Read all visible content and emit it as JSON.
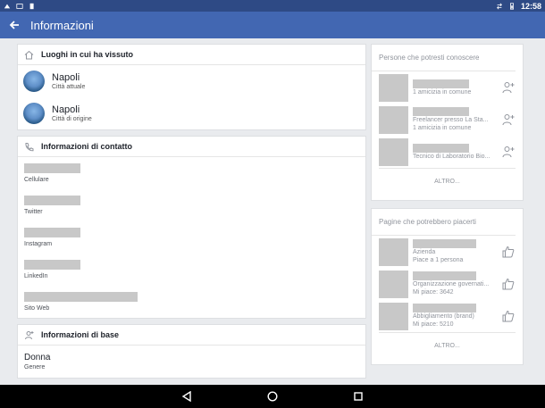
{
  "status_bar": {
    "time": "12:58"
  },
  "app_bar": {
    "title": "Informazioni"
  },
  "places": {
    "heading": "Luoghi in cui ha vissuto",
    "items": [
      {
        "name": "Napoli",
        "sub": "Città attuale"
      },
      {
        "name": "Napoli",
        "sub": "Città di origine"
      }
    ]
  },
  "contact": {
    "heading": "Informazioni di contatto",
    "items": [
      {
        "label": "Cellulare"
      },
      {
        "label": "Twitter"
      },
      {
        "label": "Instagram"
      },
      {
        "label": "LinkedIn"
      },
      {
        "label": "Sito Web"
      }
    ]
  },
  "basic": {
    "heading": "Informazioni di base",
    "value": "Donna",
    "label": "Genere"
  },
  "people": {
    "heading": "Persone che potresti conoscere",
    "items": [
      {
        "line1": "1 amicizia in comune",
        "line2": ""
      },
      {
        "line1": "Freelancer presso La Sta...",
        "line2": "1 amicizia in comune"
      },
      {
        "line1": "Tecnico di Laboratorio Bio...",
        "line2": ""
      }
    ],
    "more": "ALTRO..."
  },
  "pages": {
    "heading": "Pagine che potrebbero piacerti",
    "items": [
      {
        "line1": "Azienda",
        "line2": "Piace a 1 persona"
      },
      {
        "line1": "Organizzazione governati...",
        "line2": "Mi piace: 3642"
      },
      {
        "line1": "Abbigliamento (brand)",
        "line2": "Mi piace: 5210"
      }
    ],
    "more": "ALTRO..."
  },
  "icons": {
    "back": "back-arrow-icon",
    "home": "home-icon",
    "phone": "phone-icon",
    "person": "person-icon",
    "add_friend": "add-friend-icon",
    "like": "thumbs-up-icon"
  }
}
